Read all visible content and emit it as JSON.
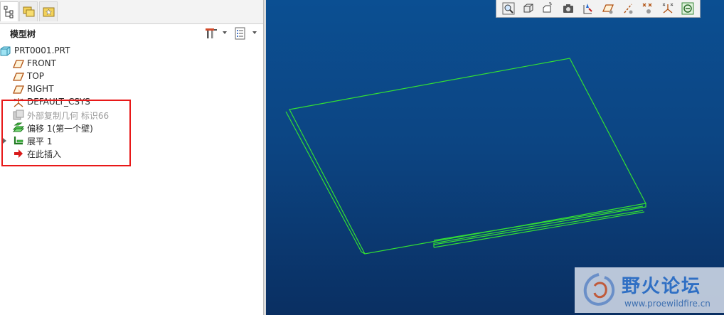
{
  "tabs": [
    {
      "name": "model-tree-tab",
      "icon": "tree-structure-icon",
      "active": true
    },
    {
      "name": "folder-browser-tab",
      "icon": "folders-icon",
      "active": false
    },
    {
      "name": "favorites-tab",
      "icon": "star-folder-icon",
      "active": false
    }
  ],
  "tree_header": {
    "title": "模型树",
    "settings_icon": "tools-icon",
    "show_icon": "list-icon"
  },
  "tree": {
    "items": [
      {
        "label": "PRT0001.PRT",
        "icon": "part-icon"
      },
      {
        "label": "FRONT",
        "icon": "datum-plane-icon"
      },
      {
        "label": "TOP",
        "icon": "datum-plane-icon"
      },
      {
        "label": "RIGHT",
        "icon": "datum-plane-icon"
      },
      {
        "label": "DEFAULT_CSYS",
        "icon": "csys-icon"
      },
      {
        "label": "外部复制几何 标识66",
        "icon": "copy-geometry-icon"
      },
      {
        "label": "偏移 1(第一个壁)",
        "icon": "offset-wall-icon"
      },
      {
        "label": "展平 1",
        "icon": "flatten-icon"
      },
      {
        "label": "在此插入",
        "icon": "insert-here-arrow-icon"
      }
    ]
  },
  "view_toolbar": [
    {
      "name": "zoom-fit-button",
      "icon": "zoom-fit-icon"
    },
    {
      "name": "display-style-button",
      "icon": "cube-icon"
    },
    {
      "name": "saved-views-button",
      "icon": "saved-view-icon"
    },
    {
      "name": "perspective-button",
      "icon": "camera-icon"
    },
    {
      "name": "datum-display-button",
      "icon": "datum-filter-icon"
    },
    {
      "name": "plane-display-button",
      "icon": "plane-display-icon"
    },
    {
      "name": "axis-display-button",
      "icon": "axis-display-icon"
    },
    {
      "name": "point-display-button",
      "icon": "point-display-icon"
    },
    {
      "name": "csys-display-button",
      "icon": "csys-display-icon"
    },
    {
      "name": "annotation-display-button",
      "icon": "annotation-display-icon"
    }
  ],
  "watermark": {
    "title": "野火论坛",
    "url": "www.proewildfire.cn"
  },
  "colors": {
    "geometry": "#33e033",
    "highlight": "#e81818",
    "viewport_top": "#0b4f92",
    "viewport_bottom": "#0a2f62"
  }
}
